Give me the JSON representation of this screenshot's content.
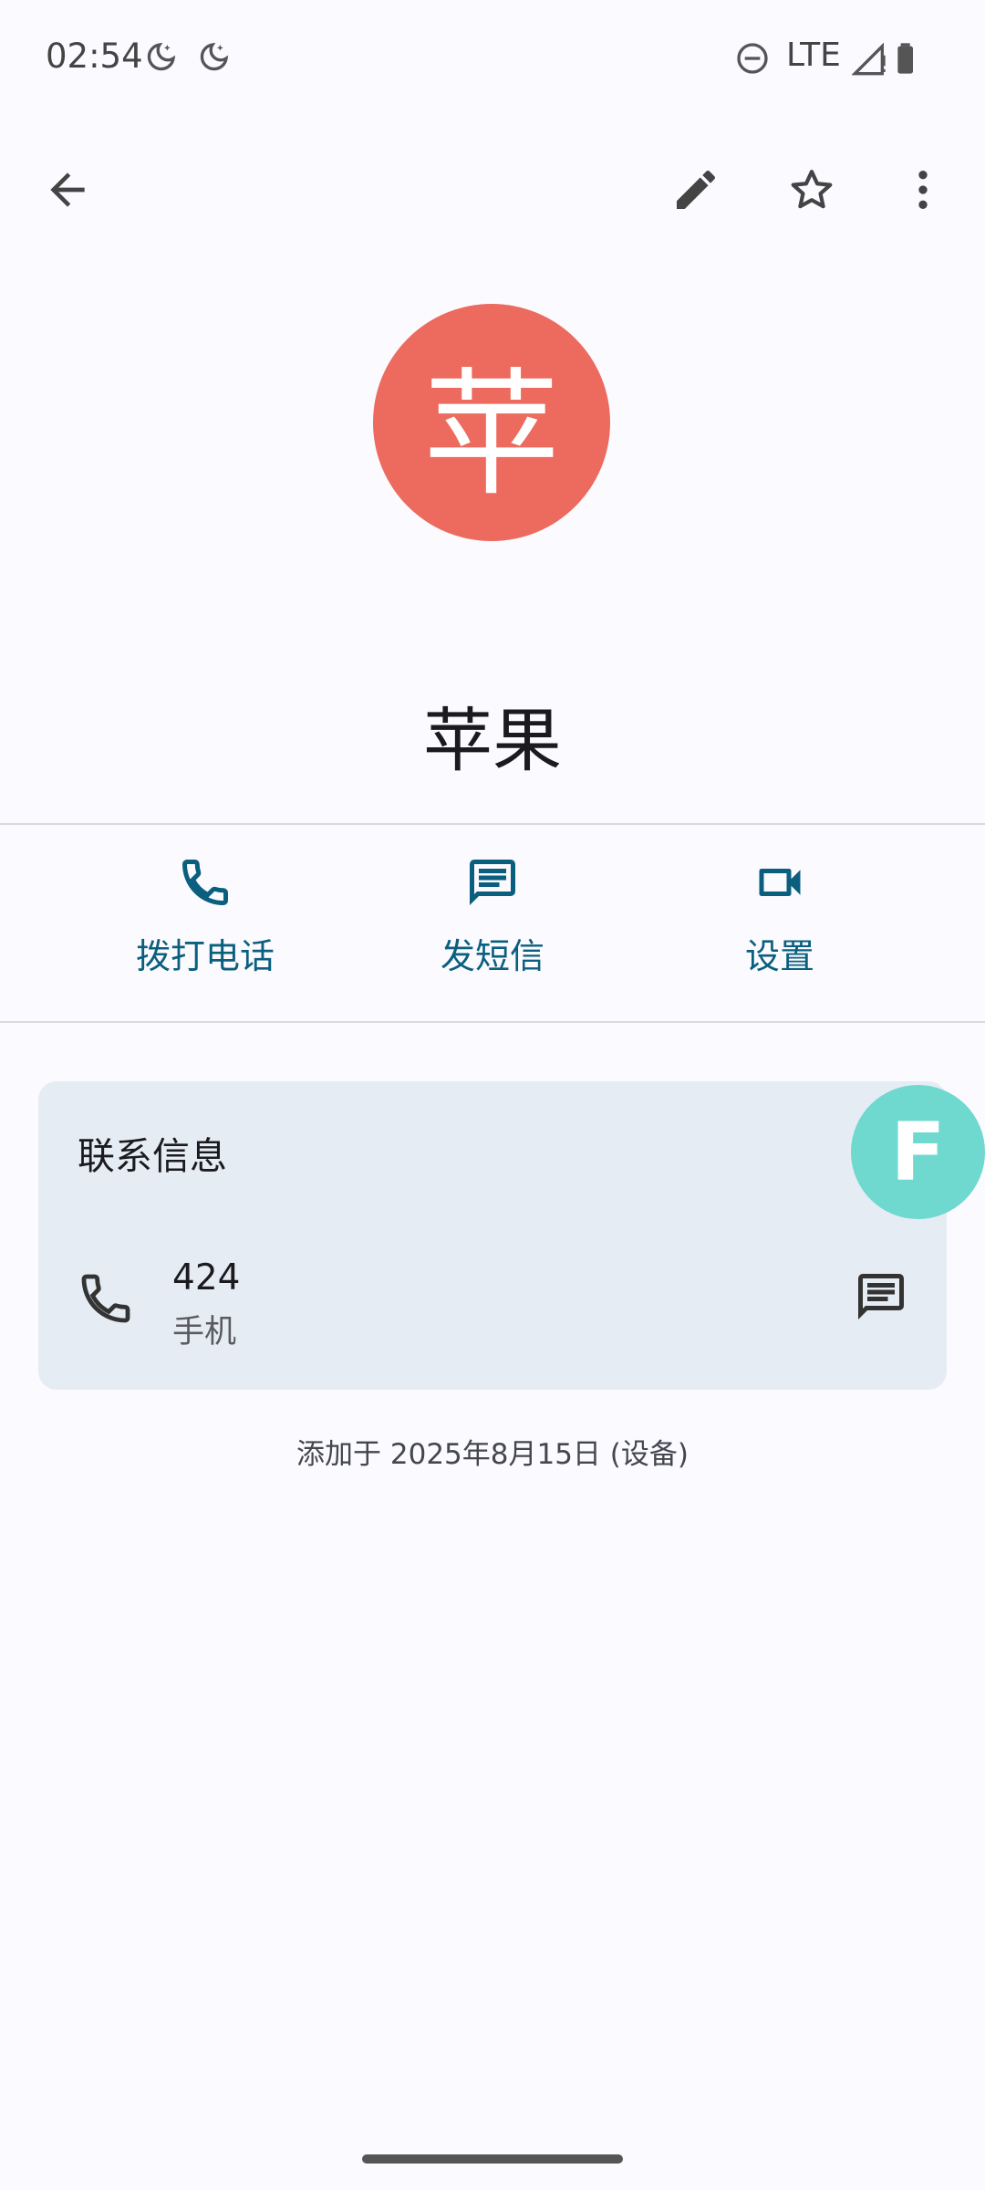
{
  "status_bar": {
    "time": "02:54",
    "network": "LTE",
    "icons": [
      "moon-icon",
      "moon-icon",
      "dnd-icon",
      "signal-icon",
      "battery-icon"
    ]
  },
  "toolbar": {
    "icons": [
      "back-arrow-icon",
      "edit-pencil-icon",
      "star-icon",
      "more-vert-icon"
    ]
  },
  "contact": {
    "avatar_letter": "苹",
    "avatar_color": "#ec6a5e",
    "name": "苹果"
  },
  "actions": [
    {
      "label": "拨打电话",
      "icon": "phone-icon"
    },
    {
      "label": "发短信",
      "icon": "message-icon"
    },
    {
      "label": "设置",
      "icon": "video-icon"
    }
  ],
  "contact_info": {
    "title": "联系信息",
    "phone_number": "424",
    "phone_type": "手机"
  },
  "added_text": "添加于 2025年8月15日 (设备)",
  "floating_bubble": {
    "letter": "F",
    "color": "#6fd9cf"
  },
  "colors": {
    "accent": "#0b5f7e",
    "background": "#fbfaff",
    "card": "#e6ecf3"
  }
}
